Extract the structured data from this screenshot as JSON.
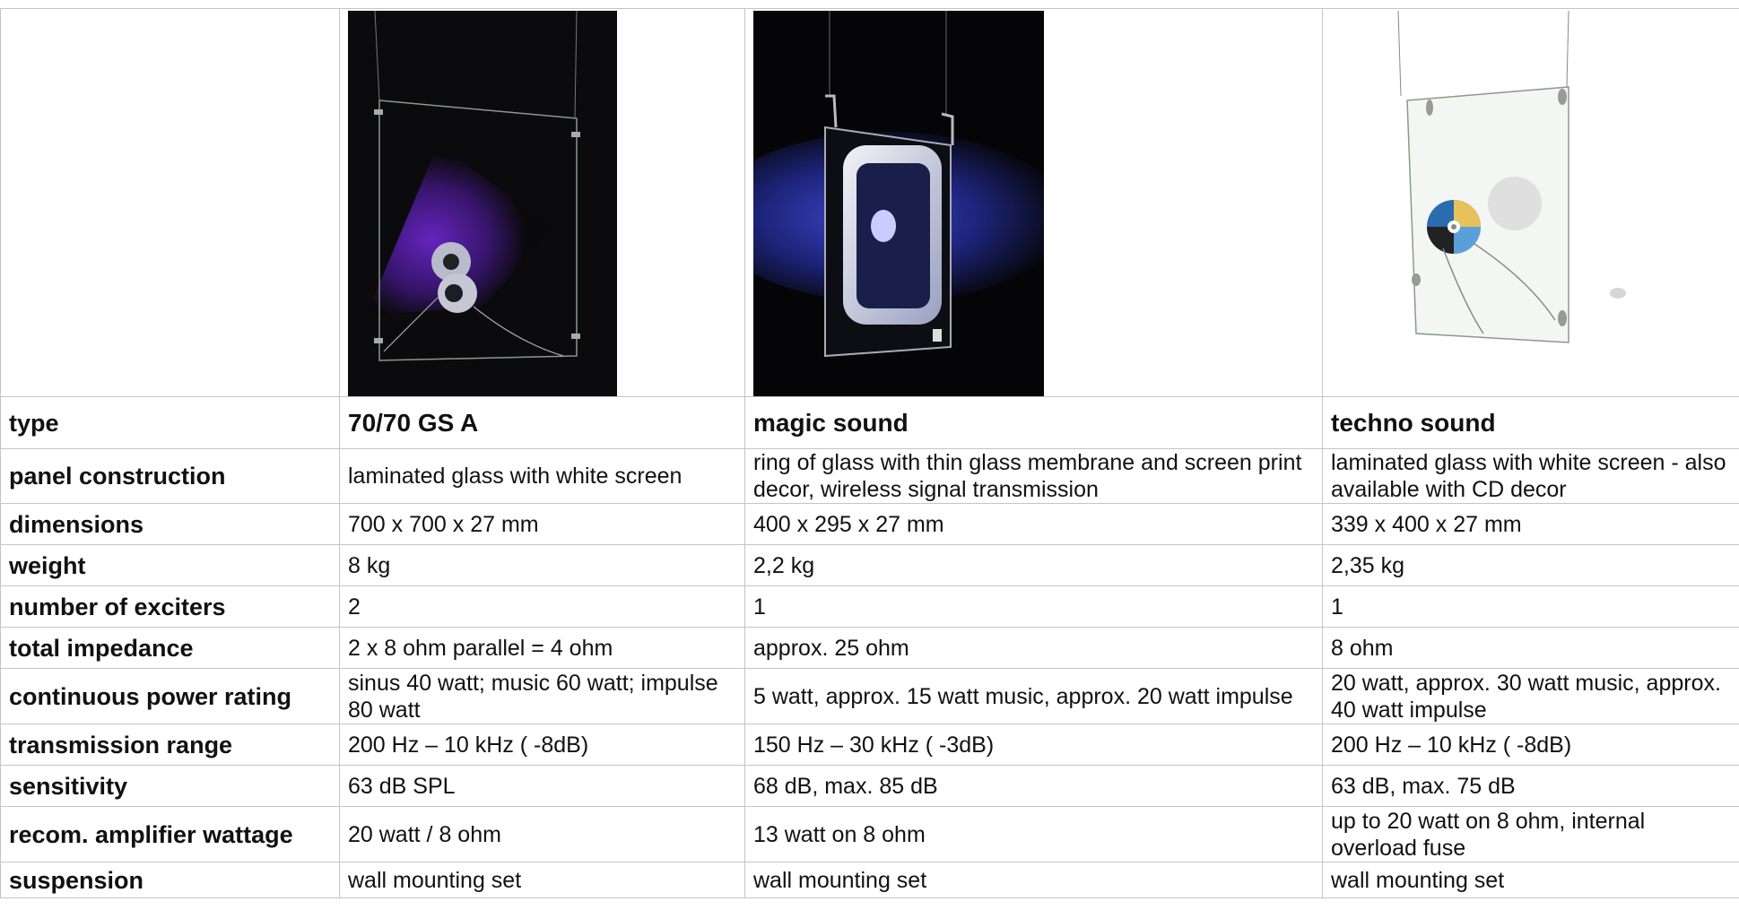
{
  "products": [
    {
      "type": "70/70 GS A",
      "image": "glass-panel-speaker-dark-purple-image"
    },
    {
      "type": "magic sound",
      "image": "glass-ring-speaker-dark-blue-image"
    },
    {
      "type": "techno sound",
      "image": "glass-panel-speaker-cd-decor-image"
    }
  ],
  "labels": {
    "type": "type",
    "panel_construction": "panel construction",
    "dimensions": "dimensions",
    "weight": "weight",
    "number_of_exciters": "number of exciters",
    "total_impedance": "total impedance",
    "continuous_power_rating": "continuous power rating",
    "transmission_range": "transmission range",
    "sensitivity": "sensitivity",
    "recom_amplifier_wattage": "recom. amplifier wattage",
    "suspension": "suspension"
  },
  "rows": {
    "panel_construction": [
      "laminated glass with white screen",
      "ring of glass with thin glass membrane and screen print decor, wireless signal transmission",
      "laminated glass with white screen - also available with CD decor"
    ],
    "dimensions": [
      "700 x 700 x 27 mm",
      "400 x 295 x 27 mm",
      "339 x 400 x 27 mm"
    ],
    "weight": [
      "8 kg",
      "2,2 kg",
      "2,35 kg"
    ],
    "number_of_exciters": [
      "2",
      "1",
      "1"
    ],
    "total_impedance": [
      "2 x 8 ohm parallel = 4 ohm",
      "approx. 25 ohm",
      "8 ohm"
    ],
    "continuous_power_rating": [
      "sinus 40 watt; music  60 watt; impulse 80 watt",
      "5 watt, approx. 15 watt music, approx. 20 watt impulse",
      "20 watt, approx. 30 watt music, approx. 40 watt impulse"
    ],
    "transmission_range": [
      "200 Hz – 10 kHz ( -8dB)",
      "150 Hz – 30 kHz ( -3dB)",
      "200 Hz – 10 kHz ( -8dB)"
    ],
    "sensitivity": [
      "63 dB SPL",
      "68 dB, max. 85 dB",
      "63 dB, max. 75 dB"
    ],
    "recom_amplifier_wattage": [
      "20 watt / 8 ohm",
      "13 watt on 8 ohm",
      "up to 20 watt on 8 ohm, internal overload fuse"
    ],
    "suspension": [
      "wall mounting set",
      "wall mounting set",
      "wall mounting set"
    ]
  }
}
